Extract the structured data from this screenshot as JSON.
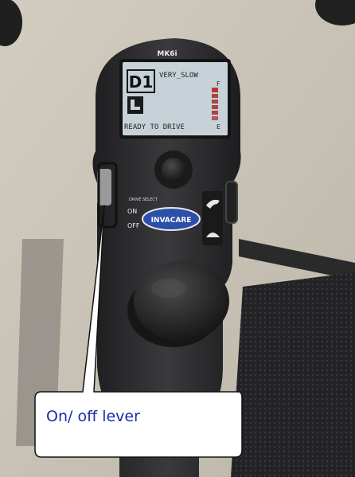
{
  "display": {
    "drive_profile": "D1",
    "speed_mode": "VERY_SLOW",
    "status": "READY TO DRIVE",
    "battery_full_mark": "F",
    "battery_empty_mark": "E"
  },
  "brand": {
    "model_badge": "MK6i",
    "logo": "INVACARE"
  },
  "controls": {
    "drive_select_label": "DRIVE SELECT",
    "on_label": "ON",
    "off_label": "OFF"
  },
  "callout": {
    "text": "On/ off lever"
  },
  "colors": {
    "carpet": "#c9c3b6",
    "housing": "#2b2b2d",
    "lcd": "#c7d2d8",
    "logo_blue": "#2c4fa8",
    "callout_text": "#1b2ea8"
  }
}
